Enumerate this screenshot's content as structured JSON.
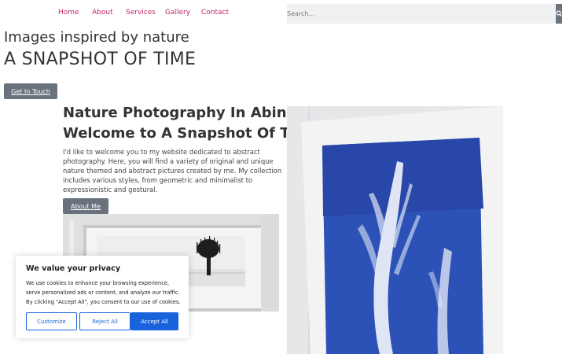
{
  "nav": {
    "items": [
      "Home",
      "About",
      "Services",
      "Gallery",
      "Contact"
    ]
  },
  "search": {
    "placeholder": "Search..."
  },
  "hero": {
    "subtitle": "Images inspired by nature",
    "title": "A SNAPSHOT OF TIME",
    "cta_label": "Get In Touch"
  },
  "intro": {
    "heading1": "Nature Photography In Abingdon",
    "heading2": "Welcome to A Snapshot Of Time",
    "body": "I'd like to welcome you to my website dedicated to abstract photography. Here, you will find a variety of original and unique nature themed and abstract pictures created by me. My collection includes various styles, from geometric and minimalist to expressionistic and gestural.",
    "cta_label": "About Me"
  },
  "cookie": {
    "title": "We value your privacy",
    "body": "We use cookies to enhance your browsing experience, serve personalized ads or content, and analyze our traffic. By clicking \"Accept All\", you consent to our use of cookies.",
    "customize_label": "Customize",
    "reject_label": "Reject All",
    "accept_label": "Accept All"
  },
  "colors": {
    "nav_link": "#c0276a",
    "button_dark": "#69727d",
    "cookie_accent": "#1863dc"
  }
}
